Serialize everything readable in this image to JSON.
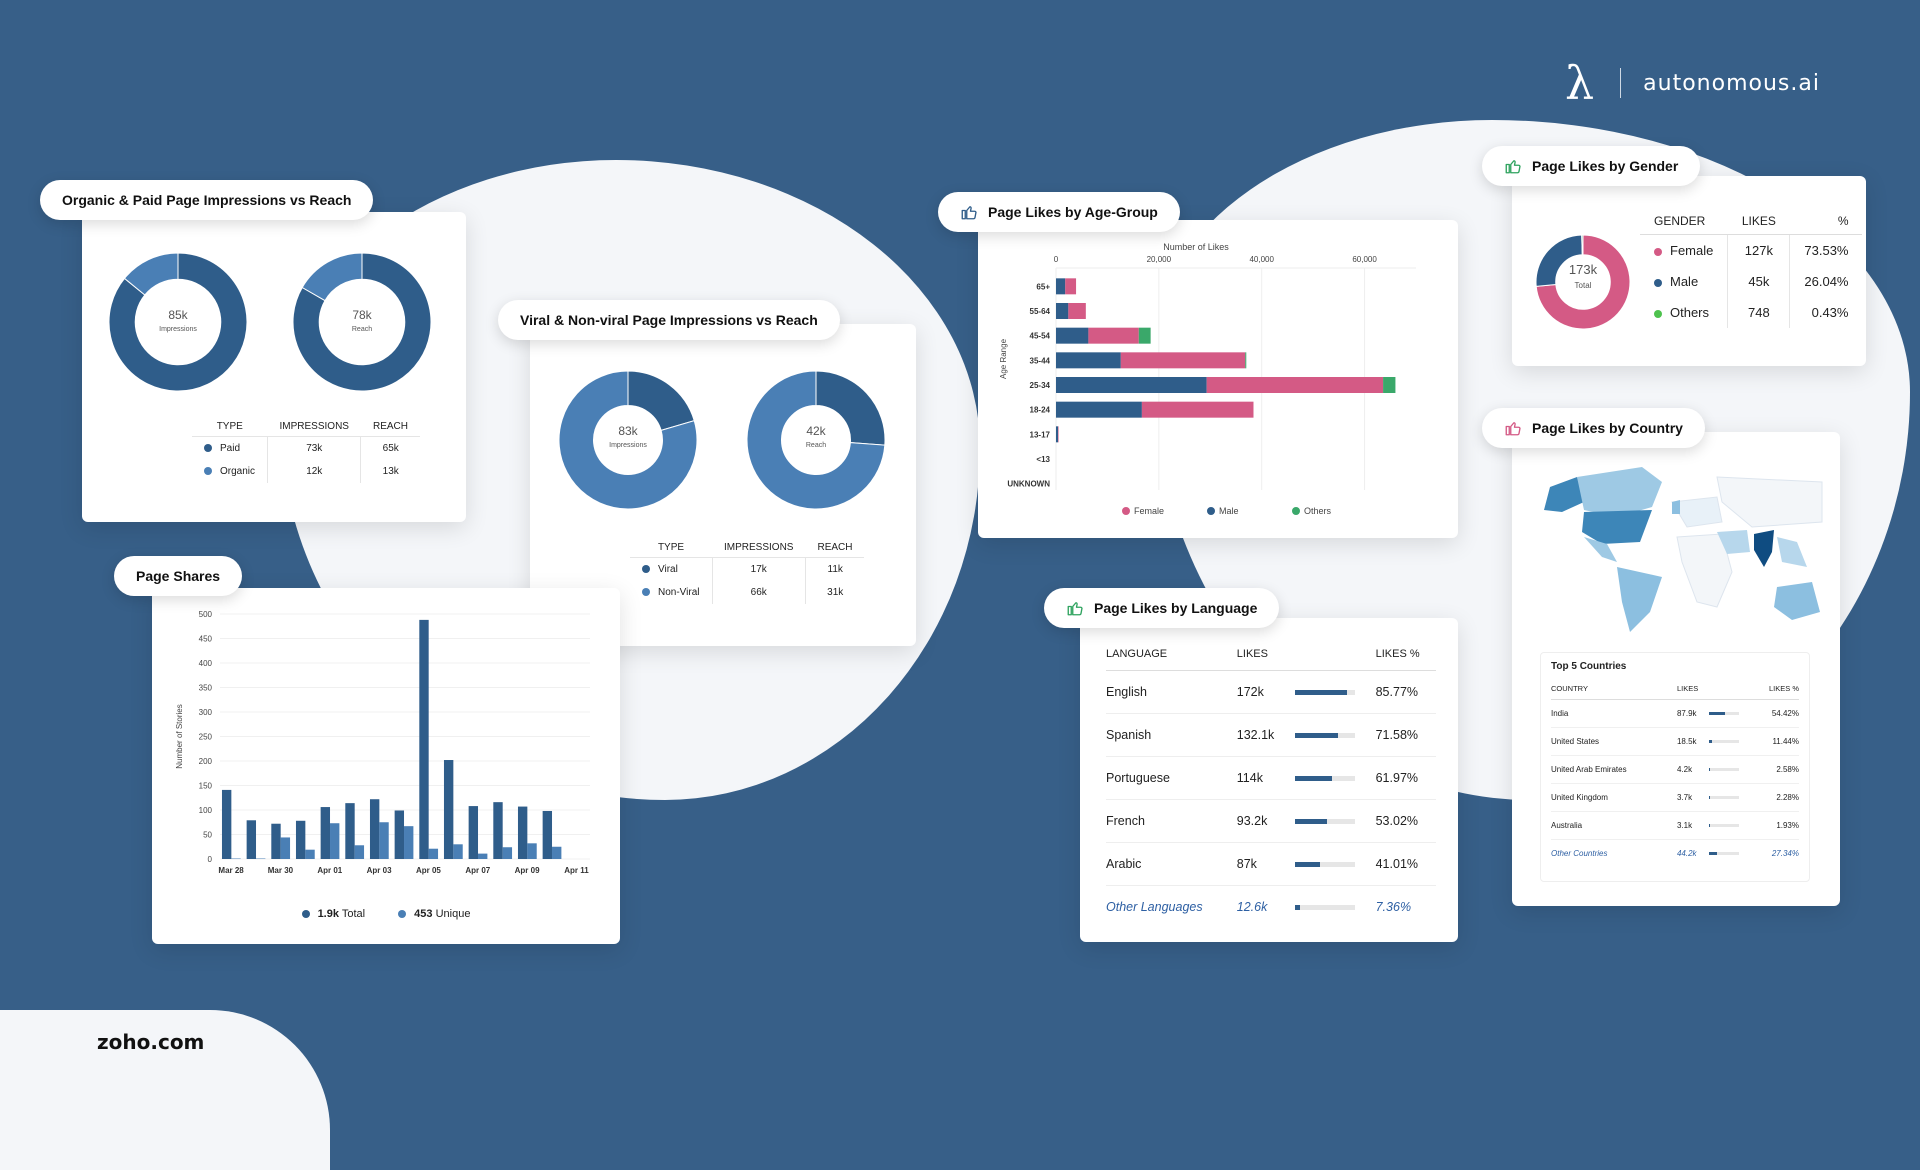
{
  "brand": {
    "logo_glyph": "λ",
    "name": "autonomous.ai"
  },
  "footer": {
    "source": "zoho.com"
  },
  "colors": {
    "background": "#375f88",
    "dark_blue": "#2f5d8a",
    "light_blue": "#4a7fb5",
    "pink": "#d45a85",
    "green": "#3aa86a"
  },
  "organic_paid": {
    "title": "Organic & Paid Page Impressions vs Reach",
    "donuts": [
      {
        "value": "85k",
        "label": "Impressions"
      },
      {
        "value": "78k",
        "label": "Reach"
      }
    ],
    "table": {
      "headers": [
        "TYPE",
        "IMPRESSIONS",
        "REACH"
      ],
      "rows": [
        {
          "type": "Paid",
          "impressions": "73k",
          "reach": "65k"
        },
        {
          "type": "Organic",
          "impressions": "12k",
          "reach": "13k"
        }
      ]
    }
  },
  "viral": {
    "title": "Viral & Non-viral Page Impressions vs Reach",
    "donuts": [
      {
        "value": "83k",
        "label": "Impressions"
      },
      {
        "value": "42k",
        "label": "Reach"
      }
    ],
    "table": {
      "headers": [
        "TYPE",
        "IMPRESSIONS",
        "REACH"
      ],
      "rows": [
        {
          "type": "Viral",
          "impressions": "17k",
          "reach": "11k"
        },
        {
          "type": "Non-Viral",
          "impressions": "66k",
          "reach": "31k"
        }
      ]
    }
  },
  "page_shares": {
    "title": "Page Shares",
    "legend": [
      {
        "value": "1.9k",
        "label": "Total"
      },
      {
        "value": "453",
        "label": "Unique"
      }
    ]
  },
  "age_group": {
    "title": "Page Likes by Age-Group"
  },
  "gender": {
    "title": "Page Likes by Gender",
    "center_value": "173k",
    "center_label": "Total",
    "headers": [
      "GENDER",
      "LIKES",
      "%"
    ],
    "rows": [
      {
        "gender": "Female",
        "likes": "127k",
        "pct": "73.53%"
      },
      {
        "gender": "Male",
        "likes": "45k",
        "pct": "26.04%"
      },
      {
        "gender": "Others",
        "likes": "748",
        "pct": "0.43%"
      }
    ]
  },
  "language": {
    "title": "Page Likes by Language",
    "headers": [
      "LANGUAGE",
      "LIKES",
      "LIKES %"
    ],
    "rows": [
      {
        "language": "English",
        "likes": "172k",
        "pct": "85.77%",
        "fraction": 0.8577
      },
      {
        "language": "Spanish",
        "likes": "132.1k",
        "pct": "71.58%",
        "fraction": 0.7158
      },
      {
        "language": "Portuguese",
        "likes": "114k",
        "pct": "61.97%",
        "fraction": 0.6197
      },
      {
        "language": "French",
        "likes": "93.2k",
        "pct": "53.02%",
        "fraction": 0.5302
      },
      {
        "language": "Arabic",
        "likes": "87k",
        "pct": "41.01%",
        "fraction": 0.4101
      },
      {
        "language": "Other Languages",
        "likes": "12.6k",
        "pct": "7.36%",
        "fraction": 0.0736
      }
    ]
  },
  "country": {
    "title": "Page Likes by Country",
    "top_title": "Top 5 Countries",
    "headers": [
      "COUNTRY",
      "LIKES",
      "LIKES %"
    ],
    "rows": [
      {
        "country": "India",
        "likes": "87.9k",
        "pct": "54.42%",
        "fraction": 0.5442
      },
      {
        "country": "United States",
        "likes": "18.5k",
        "pct": "11.44%",
        "fraction": 0.1144
      },
      {
        "country": "United Arab Emirates",
        "likes": "4.2k",
        "pct": "2.58%",
        "fraction": 0.0258
      },
      {
        "country": "United Kingdom",
        "likes": "3.7k",
        "pct": "2.28%",
        "fraction": 0.0228
      },
      {
        "country": "Australia",
        "likes": "3.1k",
        "pct": "1.93%",
        "fraction": 0.0193
      },
      {
        "country": "Other Countries",
        "likes": "44.2k",
        "pct": "27.34%",
        "fraction": 0.2734
      }
    ]
  },
  "chart_data": [
    {
      "id": "organic_paid_impressions",
      "type": "pie",
      "title": "Impressions",
      "labels": [
        "Paid",
        "Organic"
      ],
      "values": [
        73,
        12
      ],
      "colors": [
        "#2f5d8a",
        "#4a7fb5"
      ]
    },
    {
      "id": "organic_paid_reach",
      "type": "pie",
      "title": "Reach",
      "labels": [
        "Paid",
        "Organic"
      ],
      "values": [
        65,
        13
      ],
      "colors": [
        "#2f5d8a",
        "#4a7fb5"
      ]
    },
    {
      "id": "viral_impressions",
      "type": "pie",
      "title": "Impressions",
      "labels": [
        "Viral",
        "Non-Viral"
      ],
      "values": [
        17,
        66
      ],
      "colors": [
        "#2f5d8a",
        "#4a7fb5"
      ]
    },
    {
      "id": "viral_reach",
      "type": "pie",
      "title": "Reach",
      "labels": [
        "Viral",
        "Non-Viral"
      ],
      "values": [
        11,
        31
      ],
      "colors": [
        "#2f5d8a",
        "#4a7fb5"
      ]
    },
    {
      "id": "gender",
      "type": "pie",
      "title": "Total",
      "labels": [
        "Female",
        "Male",
        "Others"
      ],
      "values": [
        127000,
        45000,
        748
      ],
      "colors": [
        "#d45a85",
        "#2f5d8a",
        "#3aa86a"
      ]
    },
    {
      "id": "page_shares",
      "type": "bar",
      "title": "Page Shares",
      "xlabel": "",
      "ylabel": "Number of Stories",
      "ylim": [
        0,
        500
      ],
      "yticks": [
        0,
        50,
        100,
        150,
        200,
        250,
        300,
        350,
        400,
        450,
        500
      ],
      "categories": [
        "Mar 28",
        "Mar 29",
        "Mar 30",
        "Mar 31",
        "Apr 01",
        "Apr 02",
        "Apr 03",
        "Apr 04",
        "Apr 05",
        "Apr 06",
        "Apr 07",
        "Apr 08",
        "Apr 09",
        "Apr 10"
      ],
      "xtick_labels": [
        "Mar 28",
        "Mar 30",
        "Apr 01",
        "Apr 03",
        "Apr 05",
        "Apr 07",
        "Apr 09",
        "Apr 11"
      ],
      "series": [
        {
          "name": "Total",
          "color": "#2f5d8a",
          "values": [
            141,
            79,
            72,
            78,
            106,
            114,
            122,
            99,
            488,
            202,
            108,
            116,
            107,
            98
          ]
        },
        {
          "name": "Unique",
          "color": "#4a7fb5",
          "values": [
            1,
            1,
            44,
            19,
            73,
            28,
            75,
            67,
            21,
            30,
            11,
            24,
            32,
            25
          ]
        }
      ],
      "grid": true,
      "legend": "bottom"
    },
    {
      "id": "age_group",
      "type": "bar",
      "orientation": "horizontal",
      "stacked": true,
      "title": "Number of Likes",
      "xlabel": "Number of Likes",
      "ylabel": "Age Range",
      "xlim": [
        0,
        70000
      ],
      "xticks": [
        0,
        20000,
        40000,
        60000
      ],
      "xtick_labels": [
        "0",
        "20,000",
        "40,000",
        "60,000"
      ],
      "categories": [
        "65+",
        "55-64",
        "45-54",
        "35-44",
        "25-34",
        "18-24",
        "13-17",
        "<13",
        "UNKNOWN"
      ],
      "series": [
        {
          "name": "Male",
          "color": "#2f5d8a",
          "values": [
            1800,
            2400,
            6300,
            12600,
            29300,
            16700,
            400,
            0,
            0
          ]
        },
        {
          "name": "Female",
          "color": "#d45a85",
          "values": [
            2100,
            3400,
            9800,
            24200,
            34300,
            21700,
            100,
            0,
            0
          ]
        },
        {
          "name": "Others",
          "color": "#3aa86a",
          "values": [
            0,
            0,
            2300,
            200,
            2400,
            0,
            0,
            0,
            0
          ]
        }
      ],
      "legend_order": [
        "Female",
        "Male",
        "Others"
      ],
      "grid": true,
      "legend": "bottom"
    }
  ]
}
